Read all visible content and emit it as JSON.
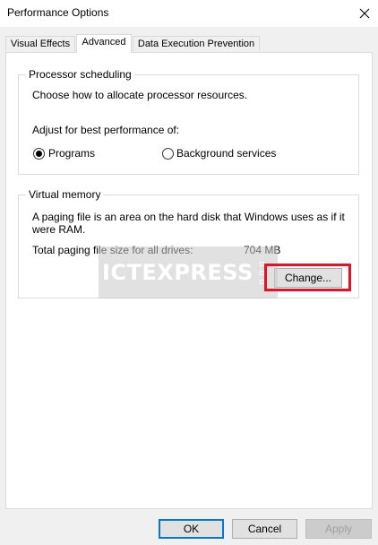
{
  "window": {
    "title": "Performance Options",
    "close_icon": "close-icon"
  },
  "tabs": [
    {
      "label": "Visual Effects",
      "selected": false
    },
    {
      "label": "Advanced",
      "selected": true
    },
    {
      "label": "Data Execution Prevention",
      "selected": false
    }
  ],
  "processor_scheduling": {
    "legend": "Processor scheduling",
    "description": "Choose how to allocate processor resources.",
    "adjust_label": "Adjust for best performance of:",
    "options": [
      {
        "label": "Programs",
        "checked": true
      },
      {
        "label": "Background services",
        "checked": false
      }
    ]
  },
  "virtual_memory": {
    "legend": "Virtual memory",
    "description_line1": "A paging file is an area on the hard disk that Windows uses as if it",
    "description_line2": "were RAM.",
    "total_label": "Total paging file size for all drives:",
    "total_value": "704 MB",
    "change_button": "Change..."
  },
  "watermark": {
    "text": "ICTEXPRESS"
  },
  "footer": {
    "ok_label": "OK",
    "cancel_label": "Cancel",
    "apply_label": "Apply"
  },
  "colors": {
    "highlight": "#e81123",
    "default_button_border": "#0078d7"
  }
}
